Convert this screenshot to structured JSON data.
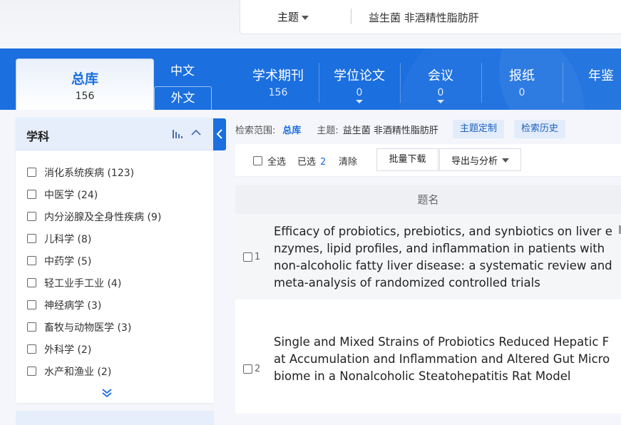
{
  "search": {
    "field": "主题",
    "query": "益生菌 非酒精性脂肪肝"
  },
  "nav": {
    "total": {
      "label": "总库",
      "count": "156"
    },
    "lang_zh": "中文",
    "lang_foreign": "外文",
    "categories": [
      {
        "label": "学术期刊",
        "count": "156"
      },
      {
        "label": "学位论文",
        "count": "0"
      },
      {
        "label": "会议",
        "count": "0"
      },
      {
        "label": "报纸",
        "count": "0"
      },
      {
        "label": "年鉴",
        "count": ""
      }
    ]
  },
  "facet": {
    "title": "学科",
    "items": [
      {
        "label": "消化系统疾病 (123)"
      },
      {
        "label": "中医学 (24)"
      },
      {
        "label": "内分泌腺及全身性疾病 (9)"
      },
      {
        "label": "儿科学 (8)"
      },
      {
        "label": "中药学 (5)"
      },
      {
        "label": "轻工业手工业 (4)"
      },
      {
        "label": "神经病学 (3)"
      },
      {
        "label": "畜牧与动物医学 (3)"
      },
      {
        "label": "外科学 (2)"
      },
      {
        "label": "水产和渔业 (2)"
      }
    ]
  },
  "scope": {
    "label": "检索范围:",
    "value": "总库",
    "topic_label": "主题:",
    "topic_value": "益生菌 非酒精性脂肪肝",
    "custom_btn": "主题定制",
    "history_btn": "检索历史"
  },
  "toolbar": {
    "select_all": "全选",
    "selected_label": "已选",
    "selected_count": "2",
    "clear": "清除",
    "batch_download": "批量下载",
    "export": "导出与分析"
  },
  "table": {
    "header": "题名",
    "rows": [
      {
        "num": "1",
        "title": "Efficacy of probiotics, prebiotics, and synbiotics on liver enzymes, lipid profiles, and inflammation in patients with non-alcoholic fatty liver disease: a systematic review and meta-analysis of randomized controlled trials"
      },
      {
        "num": "2",
        "title": "Single and Mixed Strains of Probiotics Reduced Hepatic Fat Accumulation and Inflammation and Altered Gut Microbiome in a Nonalcoholic Steatohepatitis Rat Model"
      }
    ]
  },
  "colors": {
    "brand_blue": "#1b6fdf",
    "facet_header_bg": "#e6eefb"
  }
}
